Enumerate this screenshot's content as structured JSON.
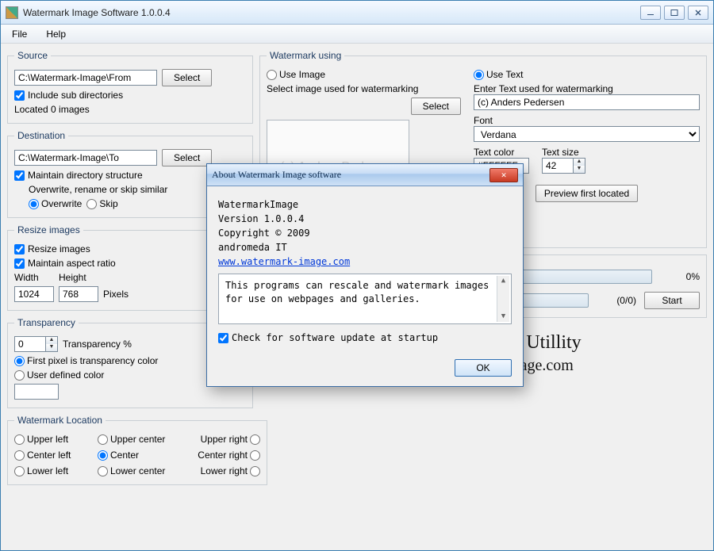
{
  "window": {
    "title": "Watermark Image Software 1.0.0.4"
  },
  "menu": {
    "file": "File",
    "help": "Help"
  },
  "source": {
    "legend": "Source",
    "path": "C:\\Watermark-Image\\From",
    "select": "Select",
    "include_sub": "Include sub directories",
    "located": "Located 0 images"
  },
  "dest": {
    "legend": "Destination",
    "path": "C:\\Watermark-Image\\To",
    "select": "Select",
    "maintain": "Maintain directory structure",
    "overwrite_label": "Overwrite, rename or skip similar",
    "overwrite": "Overwrite",
    "skip": "Skip"
  },
  "resize": {
    "legend": "Resize images",
    "resize_chk": "Resize images",
    "aspect": "Maintain aspect ratio",
    "width_label": "Width",
    "height_label": "Height",
    "pixels": "Pixels",
    "width": "1024",
    "height": "768"
  },
  "trans": {
    "legend": "Transparency",
    "pct_label": "Transparency %",
    "pct": "0",
    "first_pixel": "First pixel is transparency color",
    "user_color": "User defined color"
  },
  "loc": {
    "legend": "Watermark Location",
    "ul": "Upper left",
    "uc": "Upper center",
    "ur": "Upper right",
    "cl": "Center left",
    "cc": "Center",
    "cr": "Center right",
    "ll": "Lower left",
    "lc": "Lower center",
    "lr": "Lower right"
  },
  "wm": {
    "legend": "Watermark using",
    "use_image": "Use Image",
    "use_text": "Use Text",
    "sel_img_label": "Select image used for watermarking",
    "select": "Select",
    "enter_text_label": "Enter Text used for watermarking",
    "text_value": "(c) Anders Pedersen",
    "preview_text": "(c) Anders Pedersen",
    "font_label": "Font",
    "font_value": "Verdana",
    "color_label": "Text color",
    "color_value": "#FFFFFF",
    "size_label": "Text size",
    "size_value": "42",
    "preview_btn": "Preview first located"
  },
  "progress": {
    "pct": "0%",
    "count": "(0/0)",
    "start": "Start"
  },
  "logo": {
    "line1": "Watermark Image Utillity",
    "line2": "www.watermark-image.com"
  },
  "about": {
    "title": "About Watermark Image software",
    "name": "WatermarkImage",
    "version": "Version 1.0.0.4",
    "copyright": "Copyright ©  2009",
    "company": "andromeda IT",
    "url": "www.watermark-image.com",
    "desc": "This programs can rescale and watermark images for use on webpages and galleries.",
    "check_update": "Check for software update at startup",
    "ok": "OK"
  }
}
